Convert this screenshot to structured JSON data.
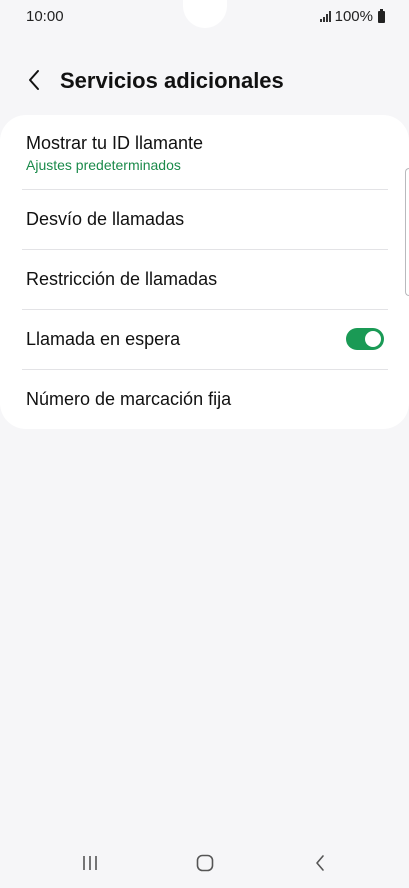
{
  "status_bar": {
    "time": "10:00",
    "battery": "100%"
  },
  "header": {
    "title": "Servicios adicionales"
  },
  "settings": {
    "items": [
      {
        "label": "Mostrar tu ID llamante",
        "subtitle": "Ajustes predeterminados"
      },
      {
        "label": "Desvío de llamadas"
      },
      {
        "label": "Restricción de llamadas"
      },
      {
        "label": "Llamada en espera",
        "toggle_on": true
      },
      {
        "label": "Número de marcación fija"
      }
    ]
  },
  "colors": {
    "accent": "#1a9a55",
    "subtitle": "#1a8a4a",
    "background": "#f6f6f8",
    "card": "#ffffff"
  },
  "navigation": {
    "icons": [
      "recent-apps-icon",
      "home-icon",
      "back-icon"
    ]
  }
}
